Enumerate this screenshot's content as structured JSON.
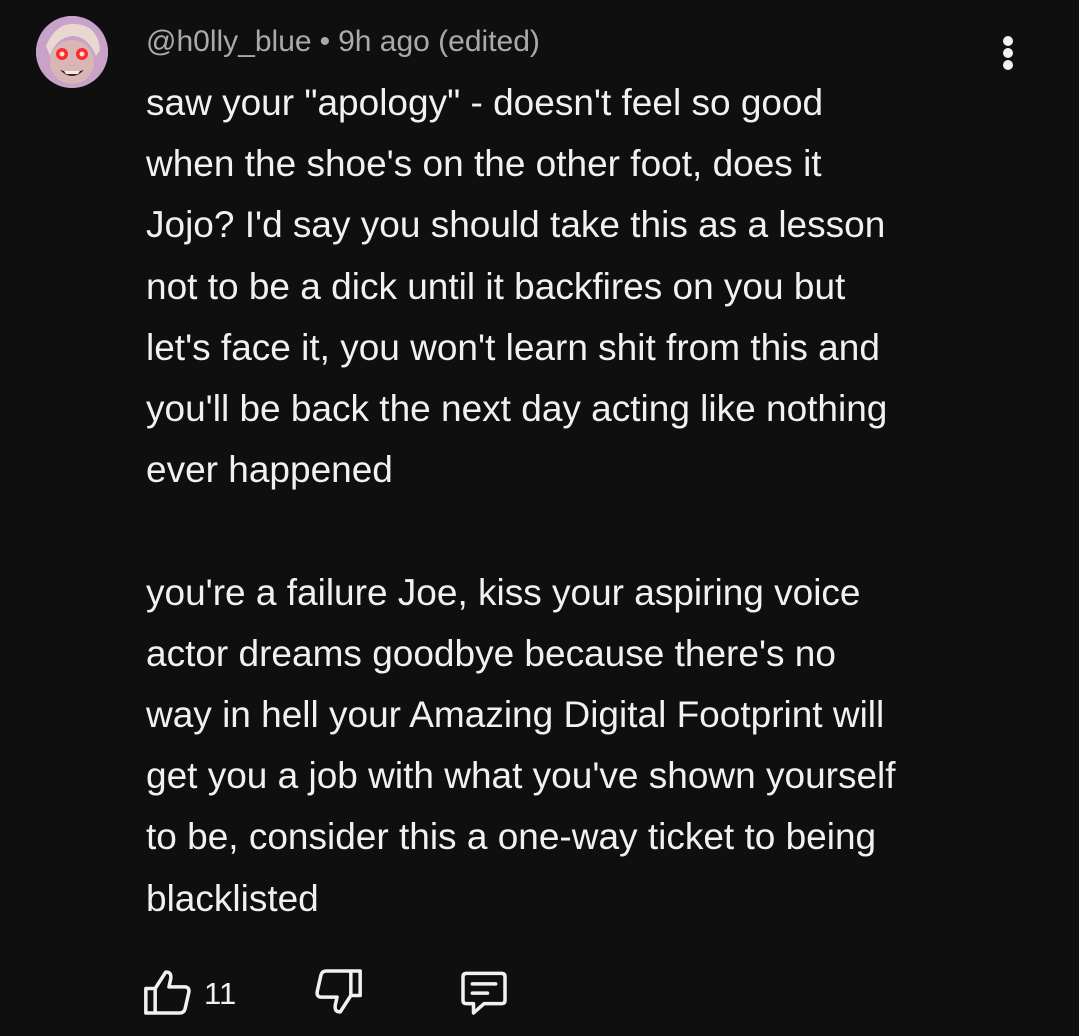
{
  "comment": {
    "author": "@h0lly_blue",
    "separator": "•",
    "timestamp": "9h ago (edited)",
    "paragraphs": [
      "saw your \"apology\" - doesn't feel so good\nwhen the shoe's on the other foot, does it\nJojo? I'd say you should take this as a lesson\nnot to be a dick until it backfires on you but\nlet's face it, you won't learn shit from this and\nyou'll be back the next day acting like nothing\never happened",
      "you're a failure Joe, kiss your aspiring voice\nactor dreams goodbye because there's no\nway in hell your Amazing Digital Footprint will\nget you a job with what you've shown yourself\nto be, consider this a one-way ticket to being\nblacklisted"
    ],
    "like_count": "11"
  },
  "icons": {
    "avatar": "avatar-image",
    "more": "more-vert-icon",
    "like": "thumbs-up-icon",
    "dislike": "thumbs-down-icon",
    "reply": "reply-comment-icon"
  },
  "colors": {
    "background": "#0f0f0f",
    "text_primary": "#f1f1f1",
    "text_secondary": "#aaaaaa"
  }
}
